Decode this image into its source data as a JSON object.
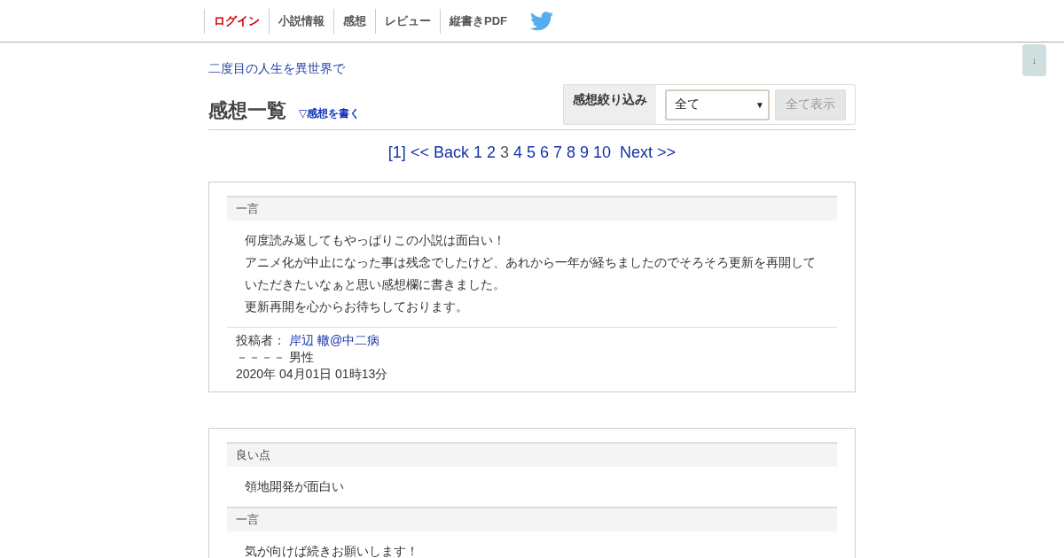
{
  "nav": [
    {
      "label": "ログイン",
      "selected": true
    },
    {
      "label": "小説情報",
      "selected": false
    },
    {
      "label": "感想",
      "selected": false
    },
    {
      "label": "レビュー",
      "selected": false
    },
    {
      "label": "縦書きPDF",
      "selected": false
    }
  ],
  "scroll_button": {
    "label": "↓"
  },
  "novel_title": "二度目の人生を異世界で",
  "page_title": "感想一覧",
  "write_link": "▽感想を書く",
  "filter": {
    "label": "感想絞り込み",
    "value": "全て",
    "caret": "▼",
    "button": "全て表示",
    "button_disabled": true
  },
  "pagination": [
    {
      "label": "[1]",
      "selected": false
    },
    {
      "label": "<< Back",
      "selected": false
    },
    {
      "label": "1",
      "selected": false
    },
    {
      "label": "2",
      "selected": false
    },
    {
      "label": "3",
      "selected": true
    },
    {
      "label": "4",
      "selected": false
    },
    {
      "label": "5",
      "selected": false
    },
    {
      "label": "6",
      "selected": false
    },
    {
      "label": "7",
      "selected": false
    },
    {
      "label": "8",
      "selected": false
    },
    {
      "label": "9",
      "selected": false
    },
    {
      "label": "10",
      "selected": false
    },
    {
      "label": "Next >>",
      "selected": false
    }
  ],
  "comments": [
    {
      "sections": [
        {
          "heading": "一言",
          "paragraphs": [
            "何度読み返してもやっぱりこの小説は面白い！",
            "アニメ化が中止になった事は残念でしたけど、あれから一年が経ちましたのでそろそろ更新を再開していただきたいなぁと思い感想欄に書きました。",
            "更新再開を心からお待ちしております。"
          ]
        }
      ],
      "footer": {
        "author_label": "投稿者：",
        "author": "岸辺 轍@中二病",
        "profile": "－－－－ 男性",
        "date": "2020年 04月01日 01時13分"
      }
    },
    {
      "sections": [
        {
          "heading": "良い点",
          "paragraphs": [
            "領地開発が面白い"
          ]
        },
        {
          "heading": "一言",
          "paragraphs": [
            "気が向けば続きお願いします！"
          ]
        }
      ]
    }
  ]
}
